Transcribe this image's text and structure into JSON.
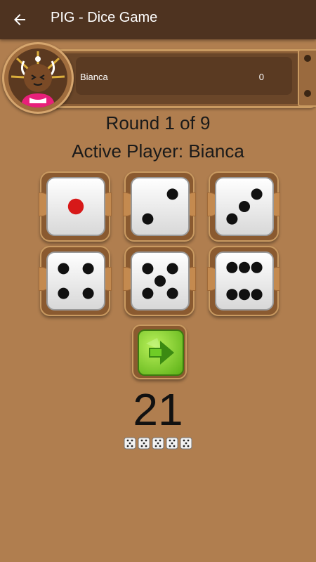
{
  "app_bar": {
    "title": "PIG - Dice Game",
    "back_icon": "arrow-left-icon"
  },
  "player": {
    "name": "Bianca",
    "score": "0",
    "avatar_icon": "character-avatar-icon"
  },
  "game": {
    "round_text": "Round 1 of 9",
    "active_player_text": "Active Player: Bianca",
    "dice": [
      1,
      2,
      3,
      4,
      5,
      6
    ],
    "total": "21",
    "roll_icon": "arrow-right-icon",
    "remaining_dice_count": 5
  },
  "colors": {
    "background": "#b07e4f",
    "appbar": "#4e3320",
    "roll_button": "#6cc21f",
    "pip": "#111111",
    "pip_one": "#d71919"
  }
}
